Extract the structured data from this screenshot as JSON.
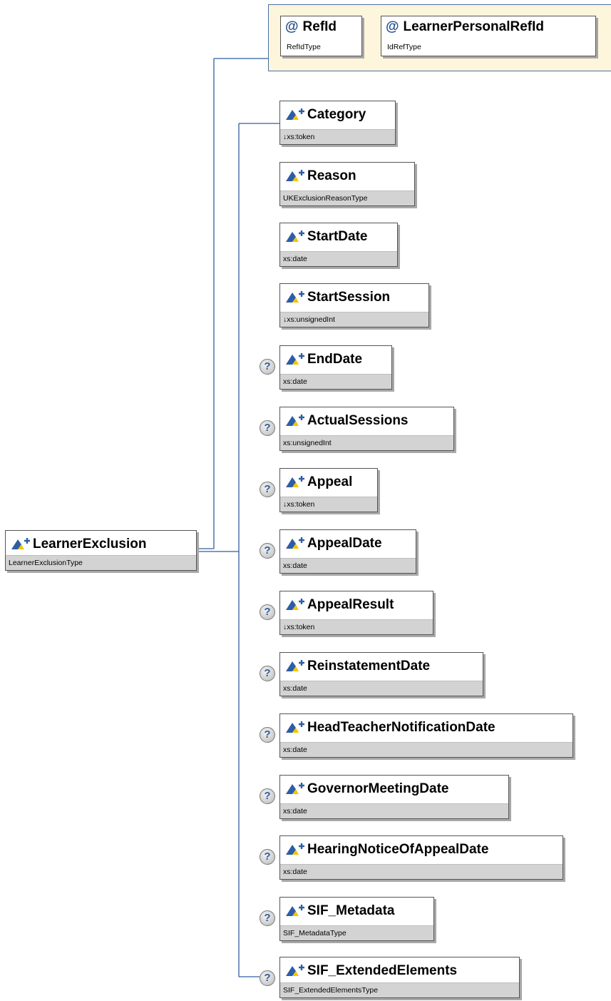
{
  "root": {
    "name": "LearnerExclusion",
    "type": "LearnerExclusionType"
  },
  "attributes": [
    {
      "name": "RefId",
      "type": "RefIdType",
      "icon": "at-sign-icon"
    },
    {
      "name": "LearnerPersonalRefId",
      "type": "IdRefType",
      "icon": "at-sign-icon"
    }
  ],
  "elements": [
    {
      "name": "Category",
      "type": "↓xs:token",
      "optional": false
    },
    {
      "name": "Reason",
      "type": "UKExclusionReasonType",
      "optional": false
    },
    {
      "name": "StartDate",
      "type": "xs:date",
      "optional": false
    },
    {
      "name": "StartSession",
      "type": "↓xs:unsignedInt",
      "optional": false
    },
    {
      "name": "EndDate",
      "type": "xs:date",
      "optional": true
    },
    {
      "name": "ActualSessions",
      "type": "xs:unsignedInt",
      "optional": true
    },
    {
      "name": "Appeal",
      "type": "↓xs:token",
      "optional": true
    },
    {
      "name": "AppealDate",
      "type": "xs:date",
      "optional": true
    },
    {
      "name": "AppealResult",
      "type": "↓xs:token",
      "optional": true
    },
    {
      "name": "ReinstatementDate",
      "type": "xs:date",
      "optional": true
    },
    {
      "name": "HeadTeacherNotificationDate",
      "type": "xs:date",
      "optional": true
    },
    {
      "name": "GovernorMeetingDate",
      "type": "xs:date",
      "optional": true
    },
    {
      "name": "HearingNoticeOfAppealDate",
      "type": "xs:date",
      "optional": true
    },
    {
      "name": "SIF_Metadata",
      "type": "SIF_MetadataType",
      "optional": true
    },
    {
      "name": "SIF_ExtendedElements",
      "type": "SIF_ExtendedElementsType",
      "optional": true
    }
  ],
  "optional_marker": "?",
  "colors": {
    "connector": "#2f5f9f",
    "attribute_group_fill": "#fdf6dc",
    "type_row": "#d3d3d3",
    "icon_blue": "#2d5da6",
    "icon_yellow": "#f2c500"
  }
}
